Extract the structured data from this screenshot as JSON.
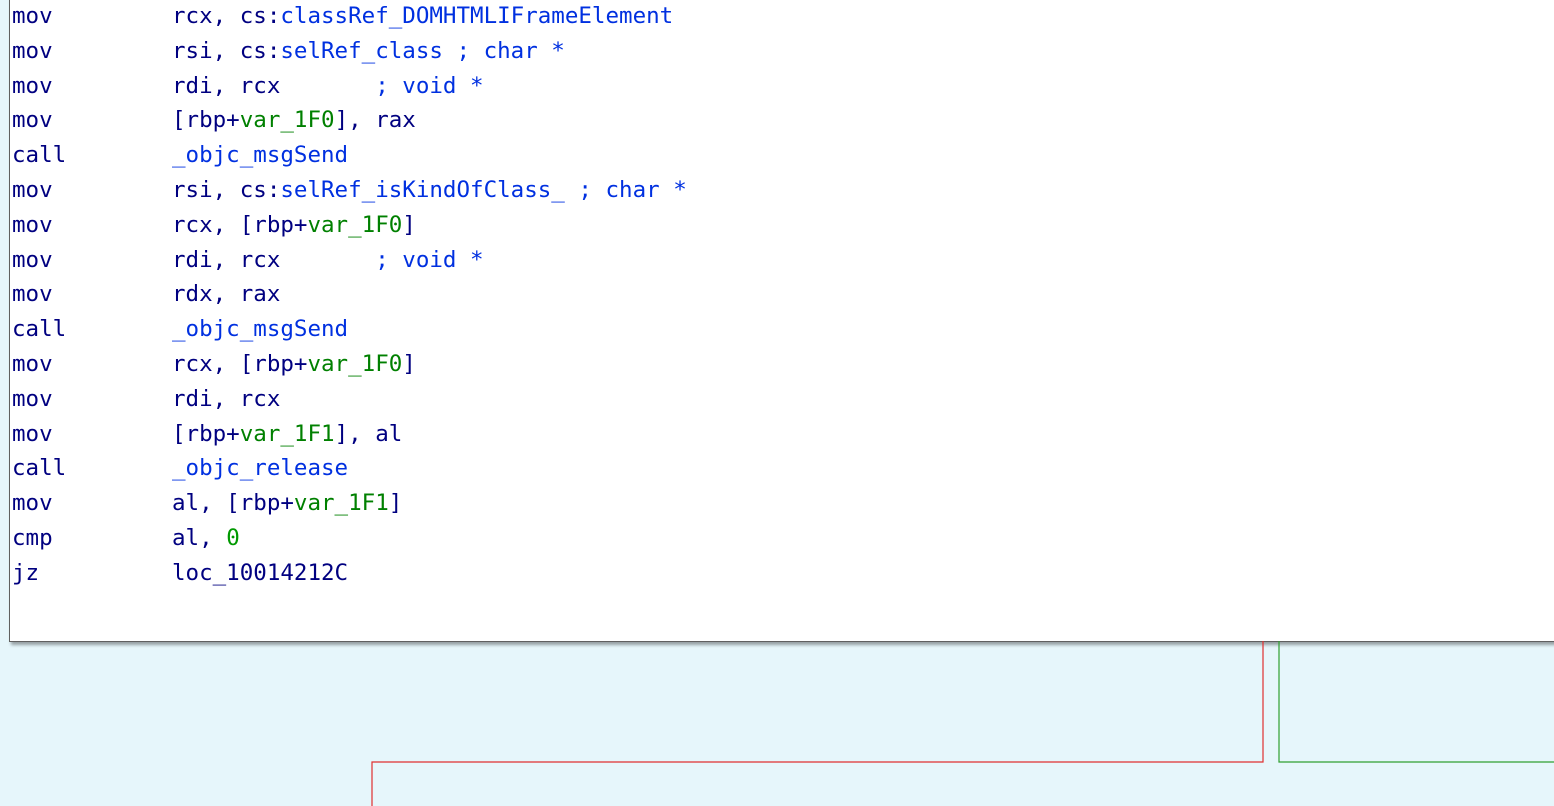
{
  "colors": {
    "background": "#e6f6fb",
    "block_background": "#ffffff",
    "instruction": "#000080",
    "symbol": "#0030e0",
    "variable": "#008000",
    "constant": "#009900",
    "comment": "#0030e0",
    "edge_false": "#e03030",
    "edge_true": "#30a030"
  },
  "instructions": [
    {
      "mnemonic": "mov",
      "operands": [
        {
          "t": "rcx, cs:",
          "k": "plain"
        },
        {
          "t": "classRef_DOMHTMLIFrameElement",
          "k": "sym"
        }
      ]
    },
    {
      "mnemonic": "mov",
      "operands": [
        {
          "t": "rsi, cs:",
          "k": "plain"
        },
        {
          "t": "selRef_class",
          "k": "sym"
        },
        {
          "t": " ; char *",
          "k": "cmt"
        }
      ]
    },
    {
      "mnemonic": "mov",
      "operands": [
        {
          "t": "rdi, rcx       ",
          "k": "plain"
        },
        {
          "t": "; void *",
          "k": "cmt"
        }
      ]
    },
    {
      "mnemonic": "mov",
      "operands": [
        {
          "t": "[rbp+",
          "k": "plain"
        },
        {
          "t": "var_1F0",
          "k": "var"
        },
        {
          "t": "], rax",
          "k": "plain"
        }
      ]
    },
    {
      "mnemonic": "call",
      "operands": [
        {
          "t": "_objc_msgSend",
          "k": "sym"
        }
      ]
    },
    {
      "mnemonic": "mov",
      "operands": [
        {
          "t": "rsi, cs:",
          "k": "plain"
        },
        {
          "t": "selRef_isKindOfClass_",
          "k": "sym"
        },
        {
          "t": " ; char *",
          "k": "cmt"
        }
      ]
    },
    {
      "mnemonic": "mov",
      "operands": [
        {
          "t": "rcx, [rbp+",
          "k": "plain"
        },
        {
          "t": "var_1F0",
          "k": "var"
        },
        {
          "t": "]",
          "k": "plain"
        }
      ]
    },
    {
      "mnemonic": "mov",
      "operands": [
        {
          "t": "rdi, rcx       ",
          "k": "plain"
        },
        {
          "t": "; void *",
          "k": "cmt"
        }
      ]
    },
    {
      "mnemonic": "mov",
      "operands": [
        {
          "t": "rdx, rax",
          "k": "plain"
        }
      ]
    },
    {
      "mnemonic": "call",
      "operands": [
        {
          "t": "_objc_msgSend",
          "k": "sym"
        }
      ]
    },
    {
      "mnemonic": "mov",
      "operands": [
        {
          "t": "rcx, [rbp+",
          "k": "plain"
        },
        {
          "t": "var_1F0",
          "k": "var"
        },
        {
          "t": "]",
          "k": "plain"
        }
      ]
    },
    {
      "mnemonic": "mov",
      "operands": [
        {
          "t": "rdi, rcx",
          "k": "plain"
        }
      ]
    },
    {
      "mnemonic": "mov",
      "operands": [
        {
          "t": "[rbp+",
          "k": "plain"
        },
        {
          "t": "var_1F1",
          "k": "var"
        },
        {
          "t": "], al",
          "k": "plain"
        }
      ]
    },
    {
      "mnemonic": "call",
      "operands": [
        {
          "t": "_objc_release",
          "k": "sym"
        }
      ]
    },
    {
      "mnemonic": "mov",
      "operands": [
        {
          "t": "al, [rbp+",
          "k": "plain"
        },
        {
          "t": "var_1F1",
          "k": "var"
        },
        {
          "t": "]",
          "k": "plain"
        }
      ]
    },
    {
      "mnemonic": "cmp",
      "operands": [
        {
          "t": "al, ",
          "k": "plain"
        },
        {
          "t": "0",
          "k": "num"
        }
      ]
    },
    {
      "mnemonic": "jz",
      "operands": [
        {
          "t": "loc_10014212C",
          "k": "plain"
        }
      ]
    }
  ]
}
